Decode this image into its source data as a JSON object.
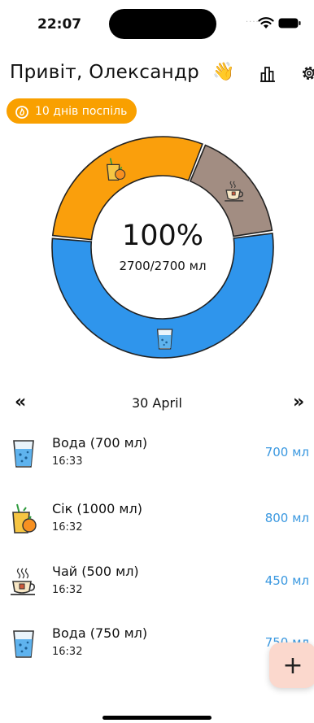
{
  "status": {
    "time": "22:07",
    "dots": "····"
  },
  "header": {
    "greeting": "Привіт, Олександр",
    "wave_emoji": "👋"
  },
  "streak": {
    "label": "10 днів поспіль"
  },
  "progress": {
    "percent_label": "100%",
    "totals_label": "2700/2700 мл",
    "segments": [
      {
        "icon": "water-glass-icon",
        "share": 0.537,
        "color": "#2f95ec"
      },
      {
        "icon": "juice-icon",
        "share": 0.296,
        "color": "#fa9f0c"
      },
      {
        "icon": "tea-icon",
        "share": 0.167,
        "color": "#a28d82"
      }
    ]
  },
  "date_nav": {
    "prev": "«",
    "next": "»",
    "date": "30 April"
  },
  "drinks": [
    {
      "name": "Вода (700 мл)",
      "time": "16:33",
      "amount": "700 мл",
      "icon": "water-glass-icon"
    },
    {
      "name": "Сік (1000 мл)",
      "time": "16:32",
      "amount": "800 мл",
      "icon": "juice-icon"
    },
    {
      "name": "Чай (500 мл)",
      "time": "16:32",
      "amount": "450 мл",
      "icon": "tea-icon"
    },
    {
      "name": "Вода (750 мл)",
      "time": "16:32",
      "amount": "750 мл",
      "icon": "water-glass-icon"
    }
  ],
  "fab": {
    "label": "+"
  }
}
